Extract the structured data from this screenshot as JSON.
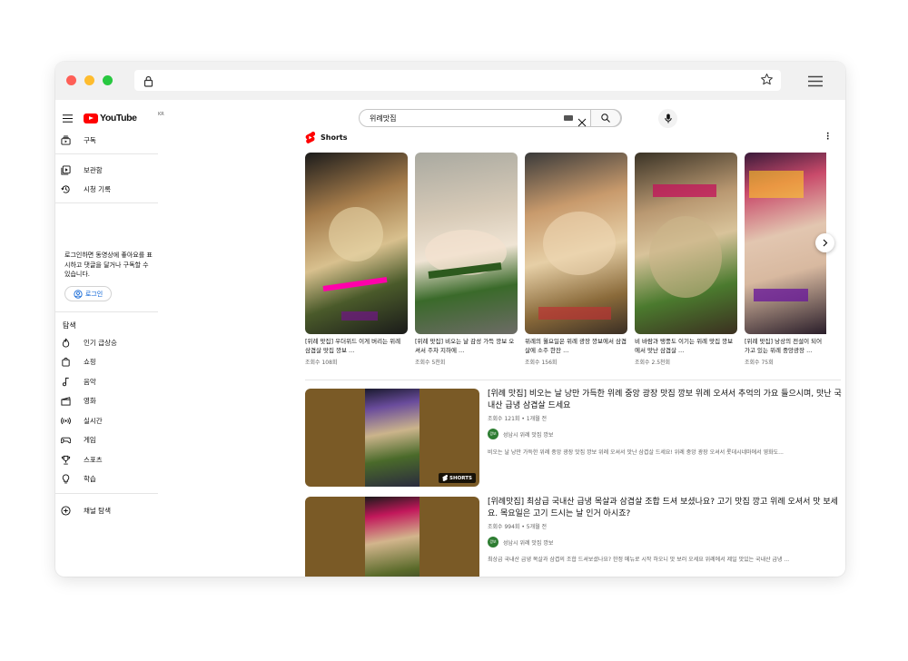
{
  "browser": {
    "url": ""
  },
  "youtube": {
    "logo_text": "YouTube",
    "region": "KR",
    "search": {
      "query": "위례맛집"
    },
    "sidebar": {
      "subscriptions": "구독",
      "library": "보관함",
      "history": "시청 기록",
      "login_prompt": "로그인하면 동영상에 좋아요를 표시하고 댓글을 달거나 구독할 수 있습니다.",
      "login_button": "로그인",
      "explore_title": "탐색",
      "explore": [
        "인기 급상승",
        "쇼핑",
        "음악",
        "영화",
        "실시간",
        "게임",
        "스포츠",
        "학습"
      ],
      "browse_channels": "채널 탐색"
    },
    "shorts": {
      "label": "Shorts",
      "items": [
        {
          "title": "[위례 맛집] 우더위드 이게 버리는 위례 삼겹살 맛집 깡보 ...",
          "views": "조회수 108회",
          "color": "#7a3e22"
        },
        {
          "title": "[위례 맛집] 비오는 날 감성 가득 깡보 오셔서 주차 지하에 ...",
          "views": "조회수 5천회",
          "color": "#6e6a5f"
        },
        {
          "title": "위례의 월요일은 위례 광장 깡보에서 삼겹살에 소주 한잔 ...",
          "views": "조회수 156회",
          "color": "#8a6a4a"
        },
        {
          "title": "비 바람과 탱풍도 이기는 위례 맛집 깡보에서 맛난 삼겹살 ...",
          "views": "조회수 2.5천회",
          "color": "#5e6a3a"
        },
        {
          "title": "[위례 맛집] 낭상의 전설이 되어가고 있는 위례 중앙광장 ...",
          "views": "조회수 75회",
          "color": "#7c3a3a"
        }
      ]
    },
    "videos": [
      {
        "title": "[위례 맛집] 비오는 날 낭만 가득한 위례 중앙 광장 맛집 깡보 위례 오셔서 추억의 가요 들으시며, 맛난 국내산 급냉 삼겹살 드세요",
        "meta": "조회수 121회 • 1개월 전",
        "channel": "성남시 위례 맛집 깡보",
        "avatar_text": "깡보",
        "description": "비오는 날 낭만 가득한 위례 중앙 광장 맛집 깡보 위례 오셔서 맛난 삼겹살 드세요! 위례 중앙 광장 오셔서 롯데시네마에서 영화도...",
        "badge": "SHORTS"
      },
      {
        "title": "[위례맛집] 최상급 국내산 급냉 목살과 삼겹살 조합 드셔 보셨나요? 고기 맛집 깡고 위례 오셔서 맛 보세요. 목요일은 고기 드시는 날 인거 아시죠?",
        "meta": "조회수 994회 • 5개월 전",
        "channel": "성남시 위례 맛집 깡보",
        "avatar_text": "깡보",
        "description": "최상급 국내산 급냉 목살과 삼겹의 조합 드셔보셨나요? 한정 메뉴로 시작 하오니 맛 보러 오세요 위례에서 제일 맛있는 국내산 급냉 ..."
      }
    ]
  }
}
